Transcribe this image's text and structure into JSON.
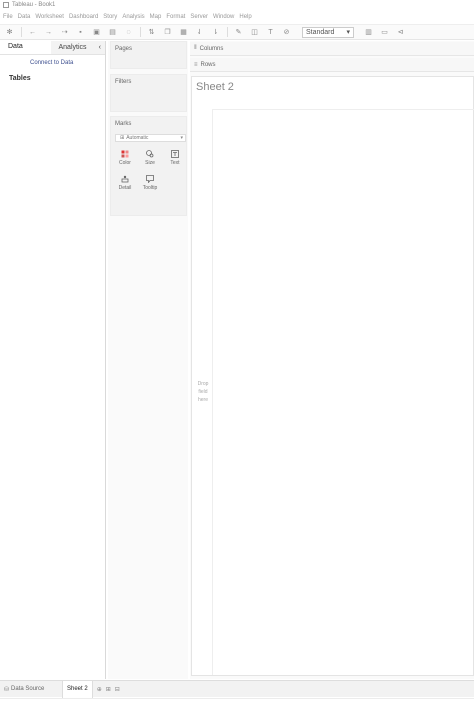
{
  "window": {
    "title": "Tableau - Book1"
  },
  "menu": [
    "File",
    "Data",
    "Worksheet",
    "Dashboard",
    "Story",
    "Analysis",
    "Map",
    "Format",
    "Server",
    "Window",
    "Help"
  ],
  "toolbar": {
    "fit_select_value": "Standard"
  },
  "left_pane": {
    "tabs": [
      {
        "label": "Data"
      },
      {
        "label": "Analytics"
      }
    ],
    "connect_link": "Connect to Data",
    "tables_heading": "Tables"
  },
  "cards": {
    "pages": "Pages",
    "filters": "Filters",
    "marks": {
      "title": "Marks",
      "mark_type": "Automatic",
      "buttons": [
        {
          "label": "Color"
        },
        {
          "label": "Size"
        },
        {
          "label": "Text"
        },
        {
          "label": "Detail"
        },
        {
          "label": "Tooltip"
        }
      ]
    }
  },
  "shelves": {
    "columns": "Columns",
    "rows": "Rows"
  },
  "sheet": {
    "title": "Sheet 2",
    "drop_hint_lines": [
      "Drop",
      "field",
      "here"
    ]
  },
  "bottom_tabs": {
    "data_source": "Data Source",
    "sheets": [
      "Sheet 2"
    ]
  }
}
